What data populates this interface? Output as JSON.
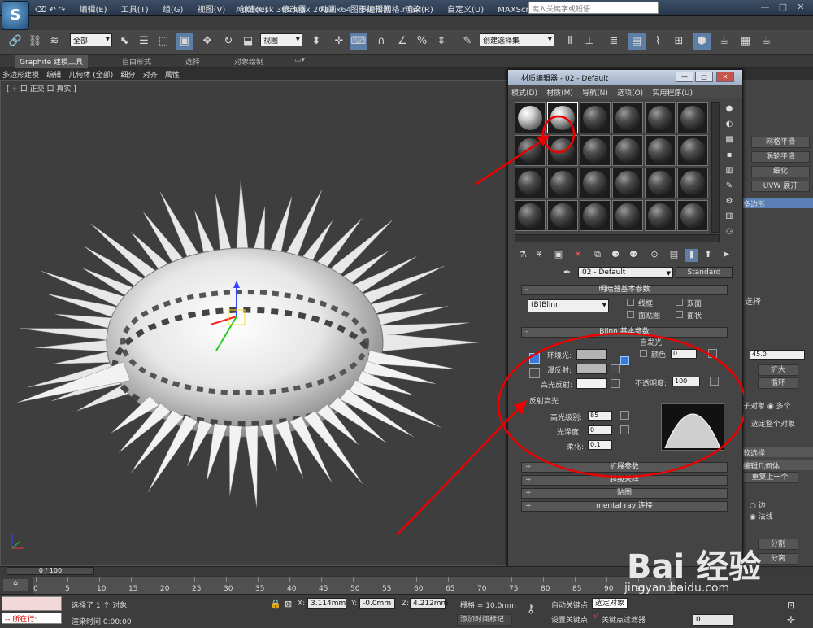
{
  "app": {
    "title": "Autodesk 3ds Max  2012 x64",
    "filename": "多边形网格.max",
    "search_placeholder": "键入关键字或短语",
    "menu": [
      "编辑(E)",
      "工具(T)",
      "组(G)",
      "视图(V)",
      "创建(C)",
      "修改器",
      "动画",
      "图形编辑器",
      "渲染(R)",
      "自定义(U)",
      "MAXScript(M)",
      "帮助(H)"
    ]
  },
  "toolbar": {
    "selection_filter": "全部",
    "ref_coord": "视图",
    "named_selection": "创建选择集"
  },
  "ribbon": {
    "tabs": [
      "Graphite 建模工具",
      "自由形式",
      "选择",
      "对象绘制"
    ],
    "sub": [
      "多边形建模",
      "编辑",
      "几何体 (全部)",
      "细分",
      "对齐",
      "属性"
    ]
  },
  "viewport": {
    "label": "[ + 口 正交 口 真实 ]"
  },
  "material_editor": {
    "title": "材质编辑器 - 02 - Default",
    "menu": [
      "模式(D)",
      "材质(M)",
      "导航(N)",
      "选项(O)",
      "实用程序(U)"
    ],
    "material_name": "02 - Default",
    "material_type": "Standard",
    "shader_rollout": "明暗器基本参数",
    "shader": "(B)Blinn",
    "shader_options": [
      "线框",
      "双面",
      "面贴图",
      "面状"
    ],
    "blinn_rollout": "Blinn 基本参数",
    "self_illum": "自发光",
    "color_label": "颜色",
    "color_value": "0",
    "ambient": "环境光:",
    "diffuse": "漫反射:",
    "specular": "高光反射:",
    "opacity_label": "不透明度:",
    "opacity_value": "100",
    "spec_group": "反射高光",
    "spec_level_label": "高光级别:",
    "spec_level": "85",
    "gloss_label": "光泽度:",
    "gloss": "0",
    "soften_label": "柔化:",
    "soften": "0.1",
    "rollouts": [
      "扩展参数",
      "超级采样",
      "贴图",
      "mental ray 连接"
    ]
  },
  "right_panel": {
    "buttons": [
      "网格平滑",
      "涡轮平滑",
      "细化",
      "UVW 展开"
    ],
    "stack_item": "多边形",
    "select_label": "选择",
    "spin_value": "45.0",
    "expand": "扩大",
    "loop": "循环",
    "by_object": "子对象",
    "many": "多个",
    "select_whole": "选定整个对象",
    "soft_select": "软选择",
    "geometry": "编辑几何体",
    "repeat_last": "重复上一个",
    "edge": "边",
    "normal": "法线",
    "split": "分割",
    "dist": "分离"
  },
  "timeline": {
    "frame": "0 / 100",
    "ticks": [
      "0",
      "5",
      "10",
      "15",
      "20",
      "25",
      "30",
      "35",
      "40",
      "45",
      "50",
      "55",
      "60",
      "65",
      "70",
      "75",
      "80",
      "85",
      "90",
      "95",
      "100"
    ]
  },
  "status": {
    "status_left": "所在行:",
    "selected": "选择了 1 个 对象",
    "render_time": "渲染时间  0:00:00",
    "x_label": "X:",
    "x": "3.114mm",
    "y_label": "Y:",
    "y": "-0.0mm",
    "z_label": "Z:",
    "z": "4.212mm",
    "grid": "栅格 = 10.0mm",
    "autokey": "自动关键点",
    "selected_obj": "选定对象",
    "setkey": "设置关键点",
    "key_filter": "关键点过滤器",
    "add_time_tag": "添加时间标记",
    "frame_field": "0"
  },
  "watermark": {
    "brand": "Bai 经验",
    "url": "jingyan.baidu.com"
  }
}
